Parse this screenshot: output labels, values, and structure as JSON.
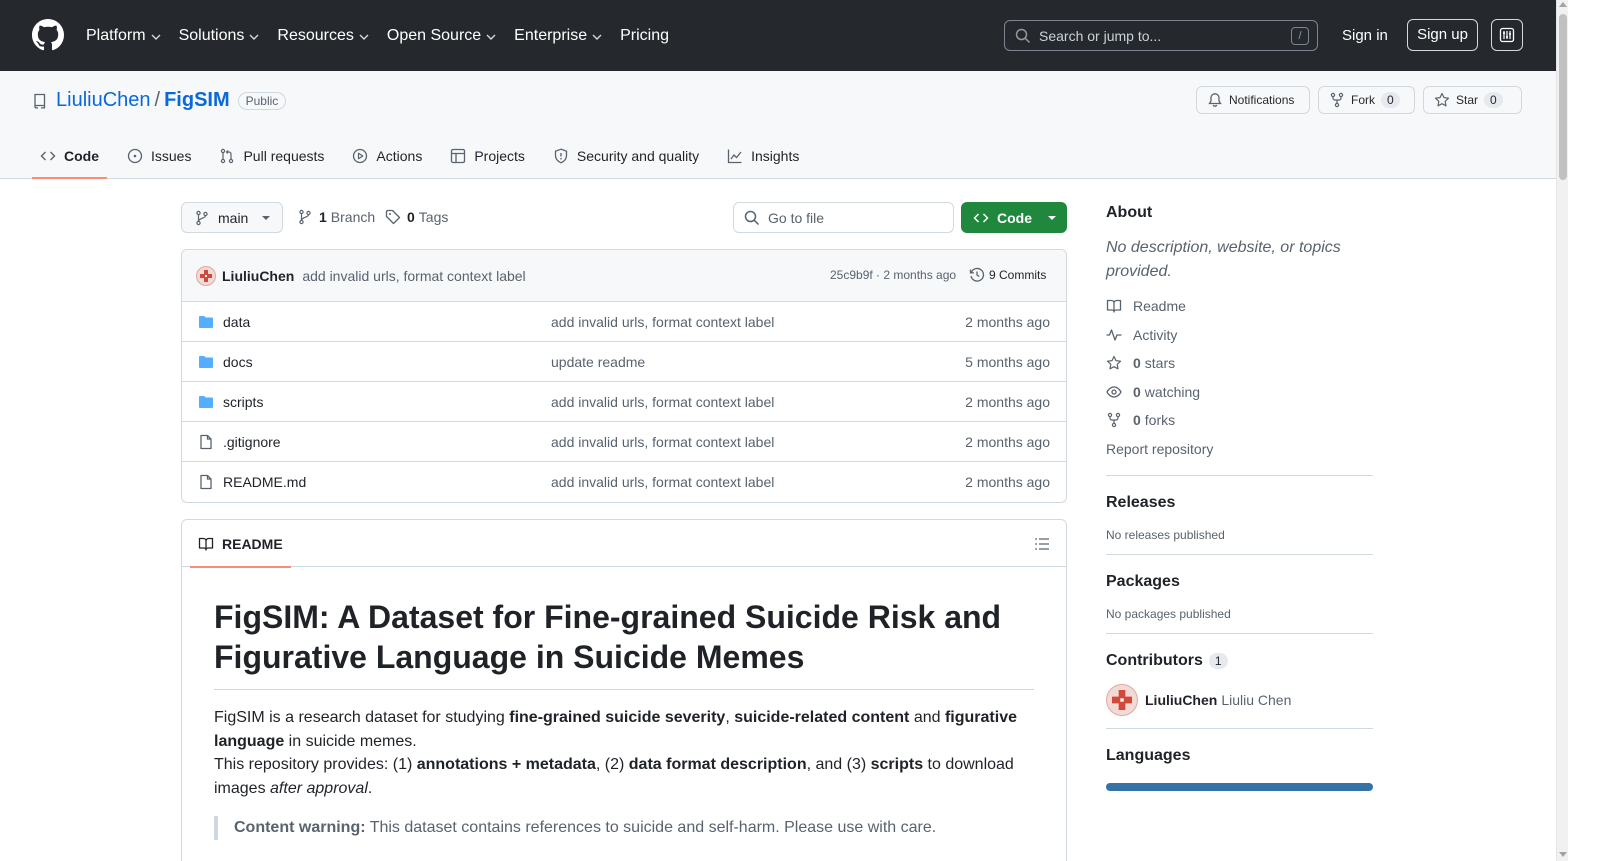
{
  "nav": {
    "items": [
      {
        "label": "Platform",
        "has_menu": true
      },
      {
        "label": "Solutions",
        "has_menu": true
      },
      {
        "label": "Resources",
        "has_menu": true
      },
      {
        "label": "Open Source",
        "has_menu": true
      },
      {
        "label": "Enterprise",
        "has_menu": true
      },
      {
        "label": "Pricing",
        "has_menu": false
      }
    ],
    "search_placeholder": "Search or jump to...",
    "search_shortcut": "/",
    "signin": "Sign in",
    "signup": "Sign up"
  },
  "repo": {
    "owner": "LiuliuChen",
    "separator": "/",
    "name": "FigSIM",
    "visibility": "Public",
    "notifications_label": "Notifications",
    "fork_label": "Fork",
    "fork_count": "0",
    "star_label": "Star",
    "star_count": "0"
  },
  "tabs": [
    {
      "label": "Code",
      "icon": "code-icon",
      "active": true
    },
    {
      "label": "Issues",
      "icon": "issue-icon"
    },
    {
      "label": "Pull requests",
      "icon": "pull-request-icon"
    },
    {
      "label": "Actions",
      "icon": "play-icon"
    },
    {
      "label": "Projects",
      "icon": "table-icon"
    },
    {
      "label": "Security and quality",
      "icon": "shield-icon"
    },
    {
      "label": "Insights",
      "icon": "graph-icon"
    }
  ],
  "toolbar": {
    "branch": "main",
    "branch_count": "1",
    "branch_label": "Branch",
    "tag_count": "0",
    "tag_label": "Tags",
    "goto_file": "Go to file",
    "code_button": "Code"
  },
  "commit": {
    "author": "LiuliuChen",
    "message": "add invalid urls, format context label",
    "hash_age": "25c9b9f · 2 months ago",
    "commits_label": "9 Commits"
  },
  "files": [
    {
      "name": "data",
      "type": "folder",
      "message": "add invalid urls, format context label",
      "age": "2 months ago"
    },
    {
      "name": "docs",
      "type": "folder",
      "message": "update readme",
      "age": "5 months ago"
    },
    {
      "name": "scripts",
      "type": "folder",
      "message": "add invalid urls, format context label",
      "age": "2 months ago"
    },
    {
      "name": ".gitignore",
      "type": "file",
      "message": "add invalid urls, format context label",
      "age": "2 months ago"
    },
    {
      "name": "README.md",
      "type": "file",
      "message": "add invalid urls, format context label",
      "age": "2 months ago"
    }
  ],
  "readme": {
    "tab_label": "README",
    "title": "FigSIM: A Dataset for Fine-grained Suicide Risk and Figurative Language in Suicide Memes",
    "p1": {
      "a": "FigSIM is a research dataset for studying ",
      "b1": "fine-grained suicide severity",
      "c": ", ",
      "b2": "suicide-related content",
      "d": " and ",
      "b3": "figurative language",
      "e": " in suicide memes."
    },
    "p2": {
      "a": "This repository provides: (1) ",
      "b1": "annotations + metadata",
      "c": ", (2) ",
      "b2": "data format description",
      "d": ", and (3) ",
      "b3": "scripts",
      "e": " to download images ",
      "i": "after approval",
      "f": "."
    },
    "warning": {
      "glyph": "",
      "bold": "Content warning:",
      "text": " This dataset contains references to suicide and self-harm. Please use with care."
    }
  },
  "about": {
    "heading": "About",
    "description": "No description, website, or topics provided.",
    "readme": "Readme",
    "activity": "Activity",
    "stars_count": "0",
    "stars_label": "stars",
    "watching_count": "0",
    "watching_label": "watching",
    "forks_count": "0",
    "forks_label": "forks",
    "report": "Report repository"
  },
  "releases": {
    "heading": "Releases",
    "text": "No releases published"
  },
  "packages": {
    "heading": "Packages",
    "text": "No packages published"
  },
  "contributors": {
    "heading": "Contributors",
    "count": "1",
    "login": "LiuliuChen",
    "full_name": "Liuliu Chen"
  },
  "languages": {
    "heading": "Languages"
  },
  "colors": {
    "header_bg": "#25292e",
    "accent": "#0969da",
    "code_button": "#1f883d",
    "tab_underline": "#fd8c73",
    "lang_bar": "#3572a5"
  }
}
